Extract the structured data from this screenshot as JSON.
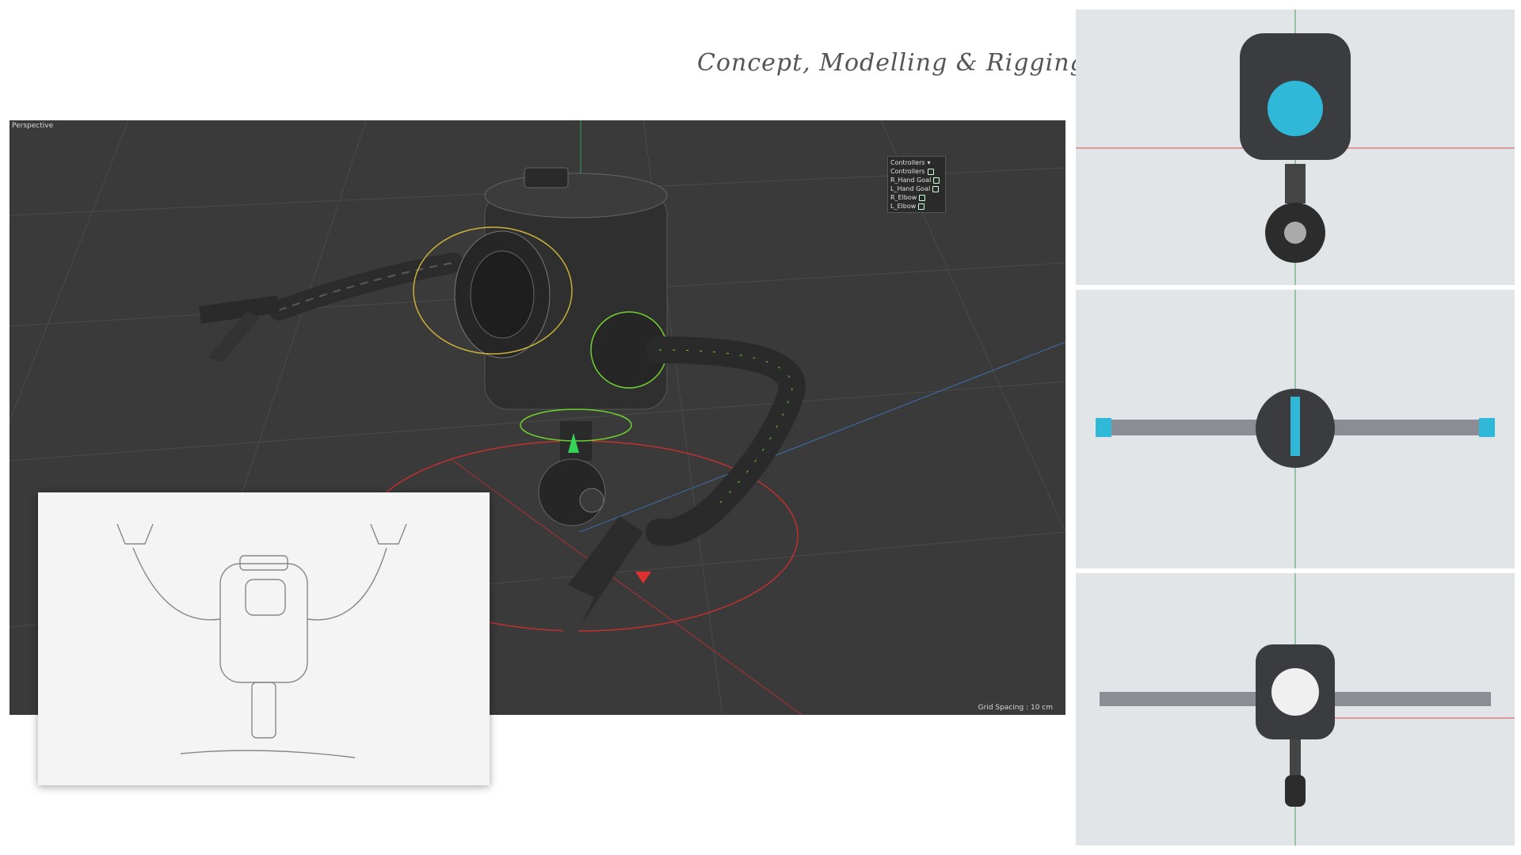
{
  "page": {
    "title": "Concept, Modelling & Rigging"
  },
  "viewport": {
    "label": "Perspective",
    "grid_spacing": "Grid Spacing : 10 cm",
    "controllers_panel": {
      "header": "Controllers",
      "items": [
        "Controllers",
        "R_Hand Goal",
        "L_Hand Goal",
        "R_Elbow",
        "L_Elbow"
      ]
    }
  },
  "colors": {
    "viewport_bg": "#3a3a3a",
    "ortho_bg": "#e2e5e8",
    "accent_cyan": "#2fb8d8",
    "rig_green": "#6fcf2f",
    "axis_red": "#d03030"
  },
  "icons": [
    "chevron-down-icon",
    "lock-icon"
  ]
}
